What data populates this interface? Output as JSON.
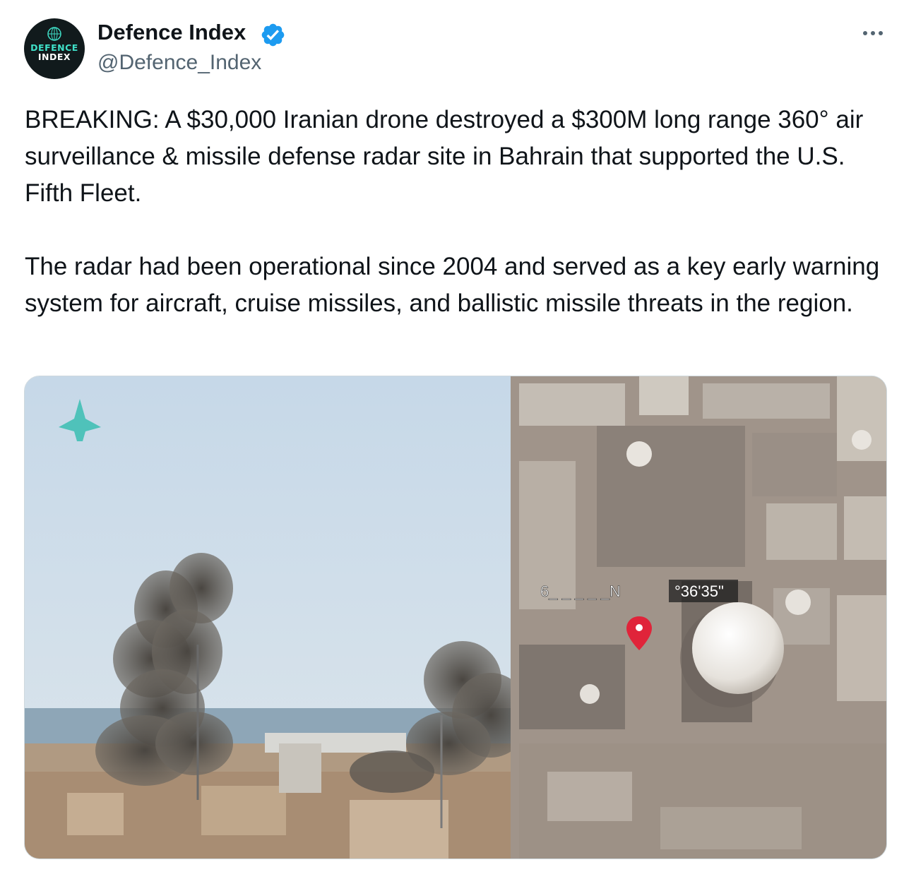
{
  "author": {
    "display_name": "Defence Index",
    "handle": "@Defence_Index",
    "verified": true,
    "avatar": {
      "line1": "DEFENCE",
      "line2": "INDEX"
    }
  },
  "tweet": {
    "paragraphs": [
      "BREAKING: A $30,000 Iranian drone destroyed a $300M long range 360° air surveillance & missile defense radar site in Bahrain that supported the U.S. Fifth Fleet.",
      "The radar had been operational since 2004 and served as a key early warning system for aircraft, cruise missiles, and ballistic missile threats in the region."
    ]
  },
  "media": {
    "overlay_coord_left": "6_ _ _ _ _N",
    "overlay_coord_right": "°36'35\""
  },
  "icons": {
    "verified": "verified-badge-icon",
    "more": "more-options-icon",
    "pin": "map-pin-icon"
  },
  "colors": {
    "text": "#0f1419",
    "secondary": "#536471",
    "verified": "#1d9bf0",
    "pin": "#e0243a"
  }
}
